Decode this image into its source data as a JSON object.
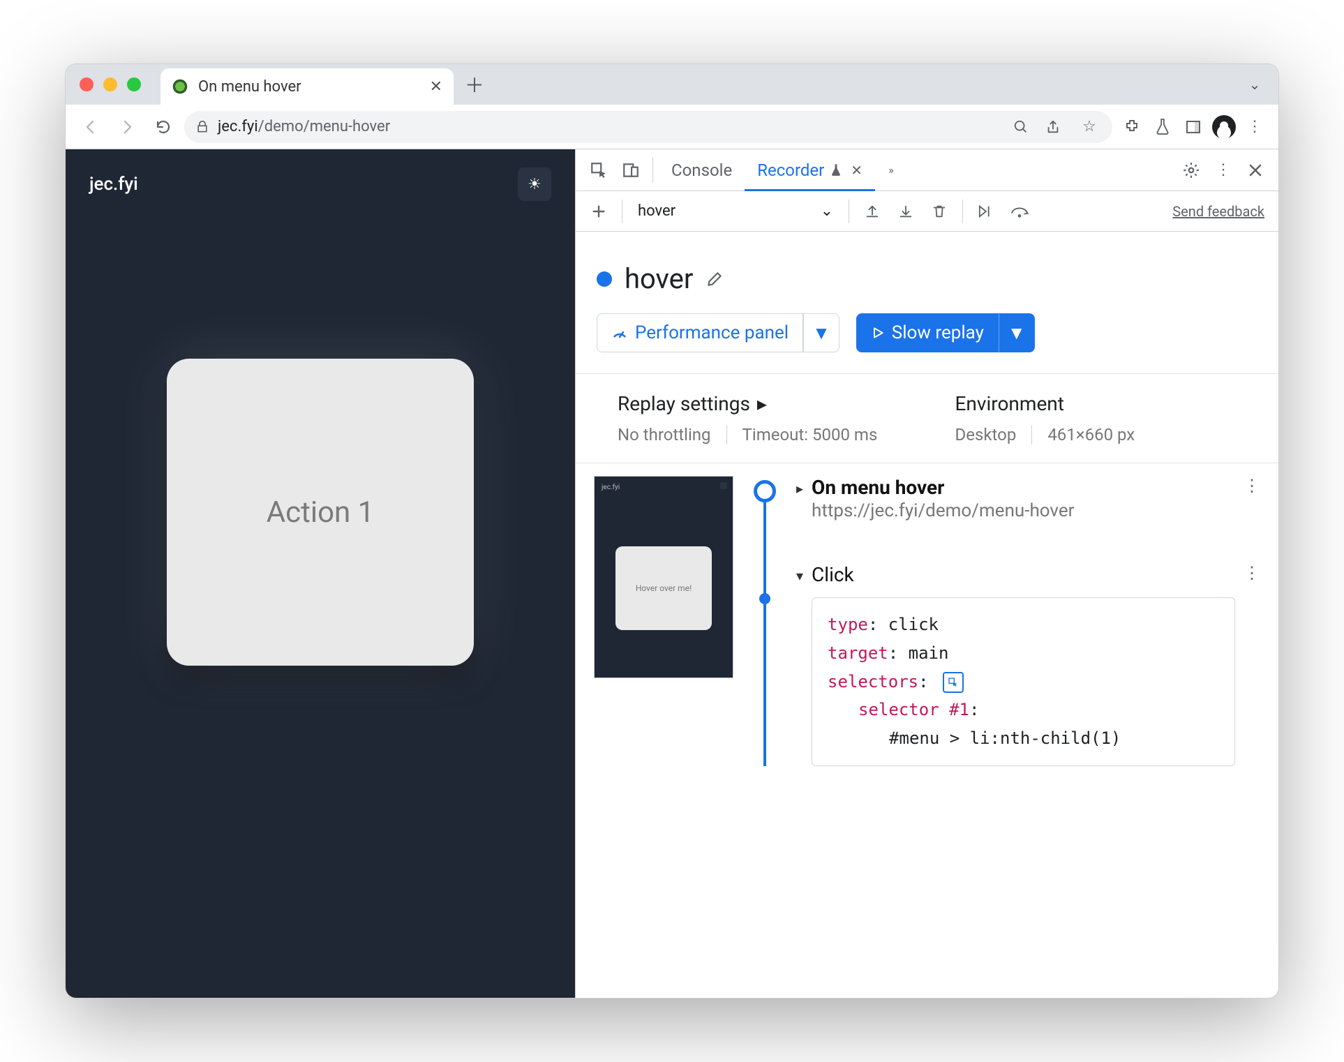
{
  "tab": {
    "title": "On menu hover"
  },
  "url": {
    "host": "jec.fyi",
    "path": "/demo/menu-hover"
  },
  "page": {
    "brand": "jec.fyi",
    "card_label": "Action 1"
  },
  "devtools": {
    "tabs": {
      "console": "Console",
      "recorder": "Recorder"
    },
    "recorder": {
      "selector_name": "hover",
      "feedback": "Send feedback",
      "title": "hover",
      "btn_perf": "Performance panel",
      "btn_replay": "Slow replay",
      "replay": {
        "heading": "Replay settings",
        "throttling": "No throttling",
        "timeout": "Timeout: 5000 ms"
      },
      "env": {
        "heading": "Environment",
        "device": "Desktop",
        "viewport": "461×660 px"
      },
      "thumb_text": "Hover over me!",
      "step_nav": {
        "title": "On menu hover",
        "url": "https://jec.fyi/demo/menu-hover"
      },
      "step_click": {
        "title": "Click",
        "code": {
          "type_k": "type",
          "type_v": "click",
          "target_k": "target",
          "target_v": "main",
          "selectors_k": "selectors",
          "selector_k": "selector",
          "selector_i": "#1",
          "selector_body": "#menu > li:nth-child(1)"
        }
      }
    }
  }
}
